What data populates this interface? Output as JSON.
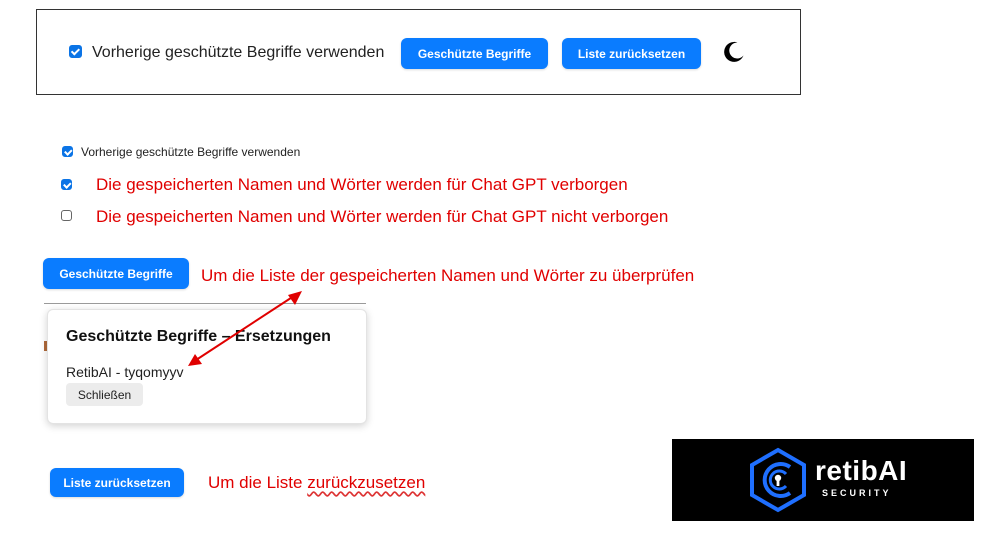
{
  "toolbar": {
    "checkbox_label": "Vorherige geschützte Begriffe verwenden",
    "protected_button": "Geschützte Begriffe",
    "reset_button": "Liste zurücksetzen",
    "theme_icon": "moon-icon"
  },
  "explanation": {
    "checkbox_label": "Vorherige geschützte Begriffe verwenden",
    "checked_note": "Die gespeicherten Namen und Wörter werden für Chat GPT verborgen",
    "unchecked_note": "Die gespeicherten Namen und Wörter werden für Chat GPT nicht verborgen",
    "protected_button": "Geschützte Begriffe",
    "protected_note": "Um die Liste der gespeicherten Namen und Wörter zu überprüfen",
    "reset_button": "Liste zurücksetzen",
    "reset_note_prefix": "Um die Liste ",
    "reset_note_word": "zurückzusetzen"
  },
  "popup": {
    "title": "Geschützte Begriffe – Ersetzungen",
    "entry": "RetibAI - tyqomyyv",
    "close_button": "Schließen"
  },
  "logo": {
    "name": "retibAI",
    "tagline": "SECURITY"
  },
  "colors": {
    "accent": "#0a7cff",
    "annotation": "#e00000",
    "logo_bg": "#000000",
    "logo_blue": "#1f6fff"
  }
}
